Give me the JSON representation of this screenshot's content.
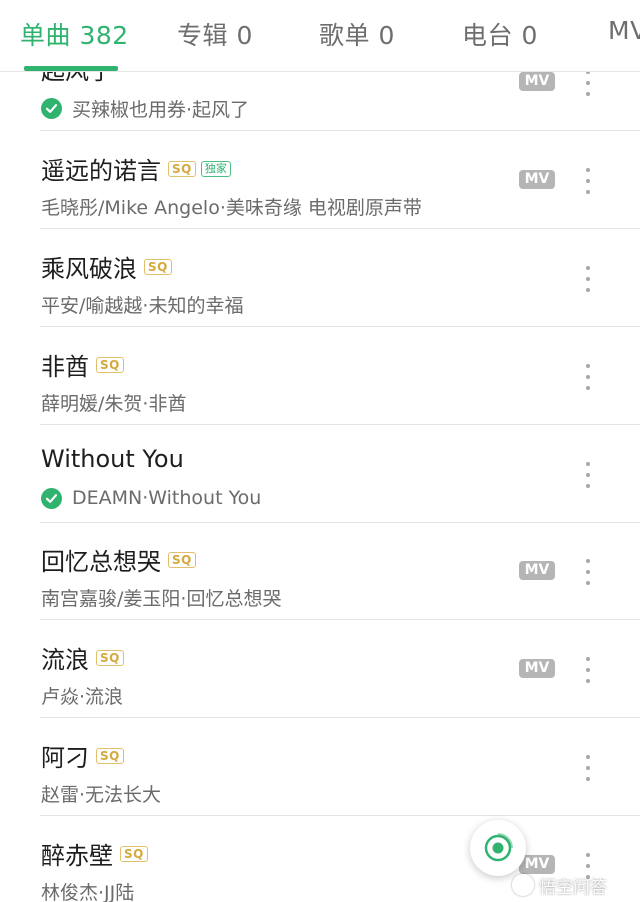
{
  "tabs": [
    {
      "label": "单曲 382",
      "active": true
    },
    {
      "label": "专辑 0",
      "active": false
    },
    {
      "label": "歌单 0",
      "active": false
    },
    {
      "label": "电台 0",
      "active": false
    },
    {
      "label": "MV",
      "active": false
    }
  ],
  "badges": {
    "sq": "SQ",
    "exclusive": "独家",
    "mv": "MV"
  },
  "colors": {
    "accent": "#2fb36f",
    "sq_badge": "#d4a93e",
    "mv_badge": "#b5b5b5"
  },
  "songs": [
    {
      "title": "起风了",
      "subtitle": "买辣椒也用券·起风了",
      "sq": false,
      "exclusive": false,
      "downloaded": true,
      "mv": true
    },
    {
      "title": "遥远的诺言",
      "subtitle": "毛晓彤/Mike Angelo·美味奇缘 电视剧原声带",
      "sq": true,
      "exclusive": true,
      "downloaded": false,
      "mv": true
    },
    {
      "title": "乘风破浪",
      "subtitle": "平安/喻越越·未知的幸福",
      "sq": true,
      "exclusive": false,
      "downloaded": false,
      "mv": false
    },
    {
      "title": "非酋",
      "subtitle": "薛明媛/朱贺·非酋",
      "sq": true,
      "exclusive": false,
      "downloaded": false,
      "mv": false
    },
    {
      "title": "Without You",
      "subtitle": "DEAMN·Without You",
      "sq": false,
      "exclusive": false,
      "downloaded": true,
      "mv": false
    },
    {
      "title": "回忆总想哭",
      "subtitle": "南宫嘉骏/姜玉阳·回忆总想哭",
      "sq": true,
      "exclusive": false,
      "downloaded": false,
      "mv": true
    },
    {
      "title": "流浪",
      "subtitle": "卢焱·流浪",
      "sq": true,
      "exclusive": false,
      "downloaded": false,
      "mv": true
    },
    {
      "title": "阿刁",
      "subtitle": "赵雷·无法长大",
      "sq": true,
      "exclusive": false,
      "downloaded": false,
      "mv": false
    },
    {
      "title": "醉赤壁",
      "subtitle": "林俊杰·JJ陆",
      "sq": true,
      "exclusive": false,
      "downloaded": false,
      "mv": true
    }
  ],
  "watermark": "悟空问答"
}
